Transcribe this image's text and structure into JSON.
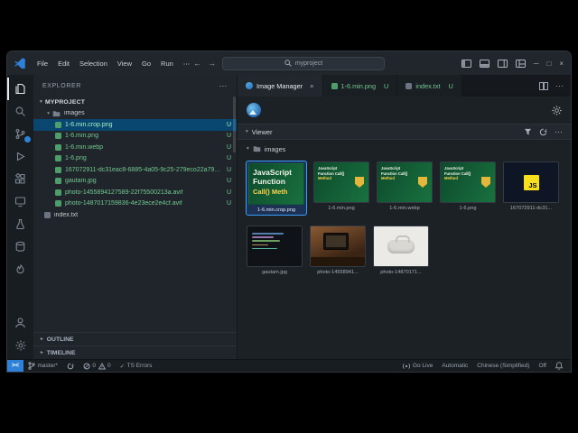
{
  "icons": {
    "chevron_down": "▾",
    "chevron_right": "▸",
    "ellipsis": "⋯",
    "close": "×",
    "minimize": "─",
    "maximize": "□",
    "back": "←",
    "forward": "→",
    "check": "✓",
    "remote_glyph": "><"
  },
  "colors": {
    "accent_blue": "#2F81D7",
    "untracked_green": "#73C991",
    "js_yellow": "#F7DF1E",
    "banner_green": "#19713F"
  },
  "titlebar": {
    "menus": [
      "File",
      "Edit",
      "Selection",
      "View",
      "Go",
      "Run",
      "⋯"
    ],
    "search": "myproject"
  },
  "sidebar": {
    "title": "EXPLORER",
    "root": "MYPROJECT",
    "folder": "images",
    "files": [
      {
        "name": "1-6.min.crop.png",
        "badge": "U"
      },
      {
        "name": "1-6.min.png",
        "badge": "U"
      },
      {
        "name": "1-6.min.webp",
        "badge": "U"
      },
      {
        "name": "1-6.png",
        "badge": "U"
      },
      {
        "name": "167072911-dc31eac8-6885-4a05-9c25-279eco22a79.png",
        "badge": "U"
      },
      {
        "name": "gautam.jpg",
        "badge": "U"
      },
      {
        "name": "photo-1455894127589-22f75500213a.avif",
        "badge": "U"
      },
      {
        "name": "photo-1487017159836-4e23ece2e4cf.avif",
        "badge": "U"
      }
    ],
    "root_file": "index.txt",
    "outline": "OUTLINE",
    "timeline": "TIMELINE"
  },
  "tabs": {
    "tab1": "Image Manager",
    "tab2": "1-6.min.png",
    "tab2_badge": "U",
    "tab3": "index.txt",
    "tab3_badge": "U"
  },
  "viewer": {
    "section": "Viewer",
    "folder": "images",
    "banner": {
      "l1": "JavaScript",
      "l2": "Function",
      "l3": "Call() Meth"
    },
    "banner_small": {
      "l1": "JavaScript",
      "l2": "Function Call()",
      "l3": "Method"
    },
    "js": "JS",
    "cards": [
      {
        "caption": "1-6.min.crop.png"
      },
      {
        "caption": "1-6.min.png"
      },
      {
        "caption": "1-6.min.webp"
      },
      {
        "caption": "1-6.png"
      },
      {
        "caption": "167072911-dc31..."
      },
      {
        "caption": "gautam.jpg"
      },
      {
        "caption": "photo-14558941..."
      },
      {
        "caption": "photo-14870171..."
      }
    ]
  },
  "statusbar": {
    "branch": "master*",
    "errors": "0",
    "warnings": "0",
    "ts_errors": "TS Errors",
    "go_live": "Go Live",
    "formatter": "Automatic",
    "language": "Chinese (Simplified)",
    "off": "Off"
  }
}
